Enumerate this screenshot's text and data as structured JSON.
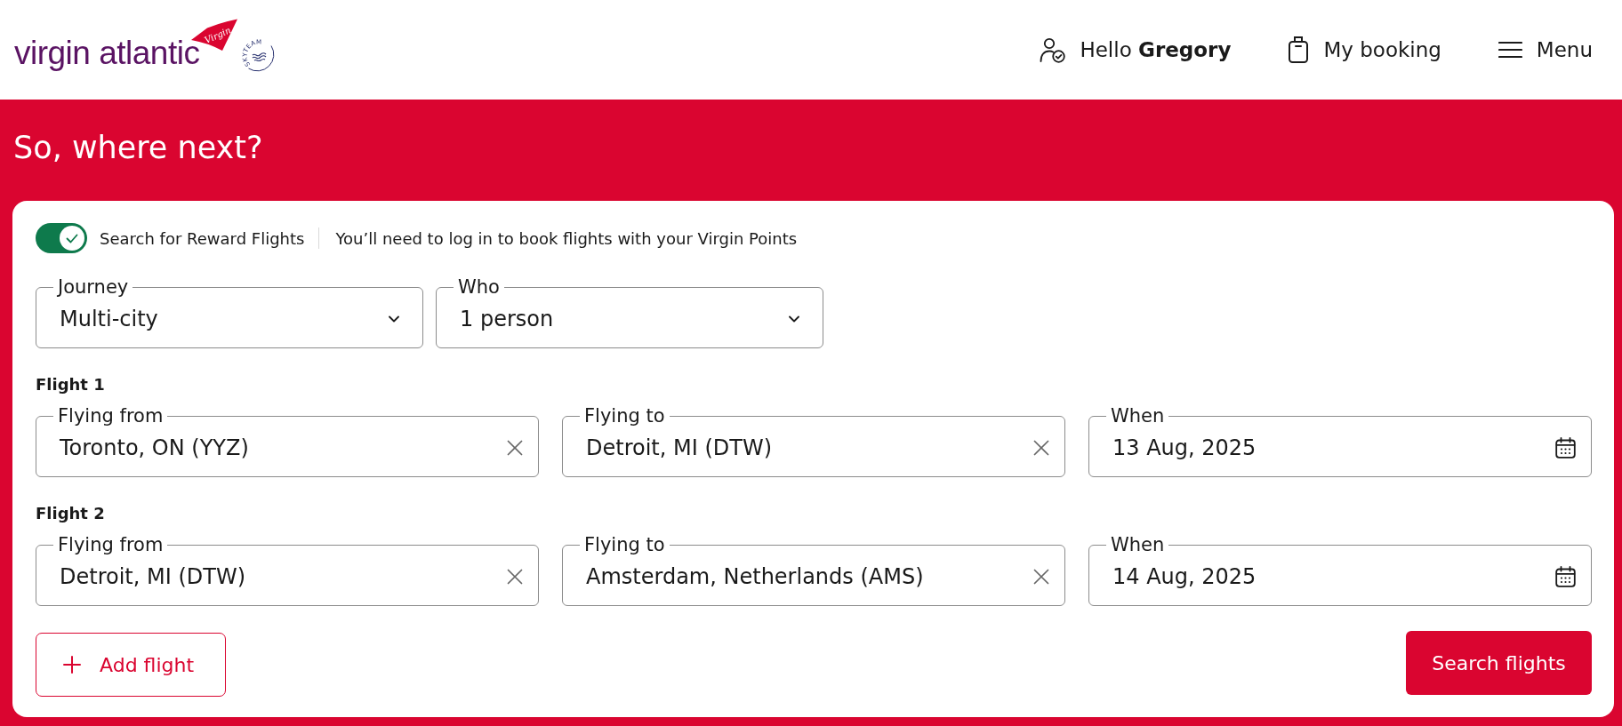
{
  "header": {
    "logo": {
      "wordmark": "virgin atlantic",
      "tail_text": "Virgin",
      "badge_text": "SKYTEAM"
    },
    "nav": [
      {
        "kind": "account",
        "text": "Hello **Gregory**"
      },
      {
        "kind": "booking",
        "text": "My booking"
      },
      {
        "kind": "menu",
        "text": "Menu"
      }
    ]
  },
  "hero": {
    "title": "So, where next?"
  },
  "search": {
    "reward_toggle": {
      "label": "Search for Reward Flights",
      "on": true
    },
    "note": "You’ll need to log in to book flights with your Virgin Points",
    "selects": [
      {
        "label": "Journey",
        "value": "Multi-city"
      },
      {
        "label": "Who",
        "value": "1 person"
      }
    ],
    "flights": [
      {
        "title": "Flight 1",
        "fields": [
          {
            "kind": "place",
            "label": "Flying from",
            "value": "Toronto, ON (YYZ)"
          },
          {
            "kind": "place",
            "label": "Flying to",
            "value": "Detroit, MI (DTW)"
          },
          {
            "kind": "date",
            "label": "When",
            "value": "13 Aug, 2025"
          }
        ]
      },
      {
        "title": "Flight 2",
        "fields": [
          {
            "kind": "place",
            "label": "Flying from",
            "value": "Detroit, MI (DTW)"
          },
          {
            "kind": "place",
            "label": "Flying to",
            "value": "Amsterdam, Netherlands (AMS)"
          },
          {
            "kind": "date",
            "label": "When",
            "value": "14 Aug, 2025"
          }
        ]
      }
    ],
    "add_button": "Add flight",
    "search_button": "Search flights"
  }
}
